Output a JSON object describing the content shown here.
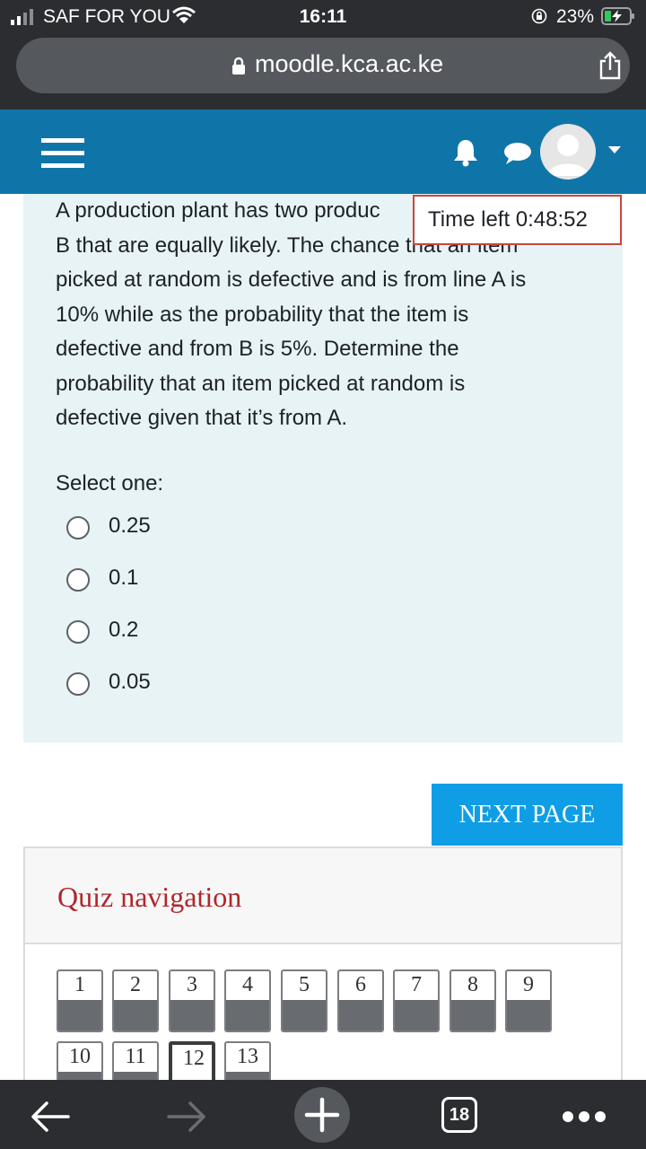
{
  "status_bar": {
    "carrier": "SAF FOR YOU",
    "time": "16:11",
    "battery": "23%"
  },
  "browser": {
    "url": "moodle.kca.ac.ke",
    "tab_count": "18"
  },
  "colors": {
    "navbar": "#0f75a8",
    "question_bg": "#e7f3f5",
    "next_button": "#0f9ee6",
    "timer_border": "#c9473d",
    "nav_title": "#b1262b"
  },
  "question": {
    "text": "A production plant has two production lines A and B that are equally likely. The chance that an item picked at random is defective and is from line A is 10% while as the probability that the item is defective and from B is 5%. Determine the probability that an item picked at random is defective given that it's from A.",
    "lines": [
      "A production plant has two produc",
      "B that are equally likely. The chance that an item",
      "picked at random is defective and is from line A is",
      "10% while as the probability that the item is",
      "defective and from B is 5%. Determine the",
      "probability that an item picked at random is",
      "defective given that it’s from A."
    ],
    "select_label": "Select one:",
    "options": [
      "0.25",
      "0.1",
      "0.2",
      "0.05"
    ]
  },
  "timer": {
    "text": "Time left 0:48:52"
  },
  "next_button": {
    "label": "NEXT PAGE"
  },
  "quiz_nav": {
    "title": "Quiz navigation",
    "current": "12",
    "buttons": [
      "1",
      "2",
      "3",
      "4",
      "5",
      "6",
      "7",
      "8",
      "9",
      "10",
      "11",
      "12",
      "13"
    ]
  }
}
